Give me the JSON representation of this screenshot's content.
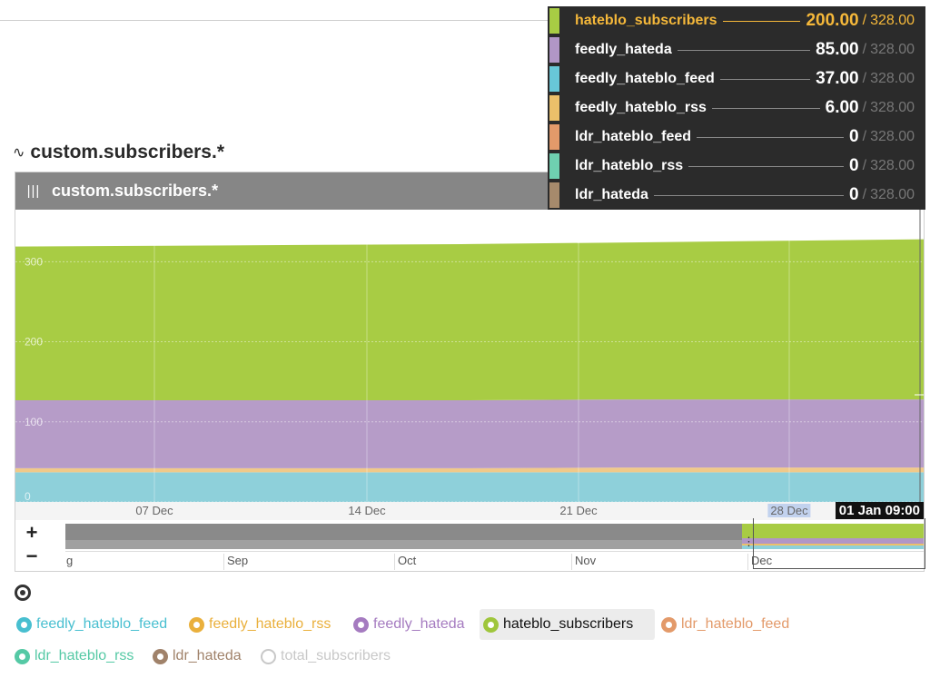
{
  "page": {
    "section_title": "custom.subscribers.*",
    "section_icon": "line-chart-icon"
  },
  "panel": {
    "title": "custom.subscribers.*",
    "menu_icon": "hamburger-icon"
  },
  "tooltip": {
    "total": "328.00",
    "rows": [
      {
        "name": "hateblo_subscribers",
        "value": "200.00",
        "color": "#a8cc44",
        "highlighted": true
      },
      {
        "name": "feedly_hateda",
        "value": "85.00",
        "color": "#b196c6"
      },
      {
        "name": "feedly_hateblo_feed",
        "value": "37.00",
        "color": "#68c7d8"
      },
      {
        "name": "feedly_hateblo_rss",
        "value": "6.00",
        "color": "#ecc06a"
      },
      {
        "name": "ldr_hateblo_feed",
        "value": "0",
        "color": "#e39a6a"
      },
      {
        "name": "ldr_hateblo_rss",
        "value": "0",
        "color": "#6fd0b0"
      },
      {
        "name": "ldr_hateda",
        "value": "0",
        "color": "#a68a6c"
      }
    ]
  },
  "chart_data": {
    "type": "area",
    "stacked": true,
    "x_ticks": [
      "07 Dec",
      "14 Dec",
      "21 Dec",
      "28 Dec"
    ],
    "selected_tick": "28 Dec",
    "cursor_time": "01 Jan 09:00",
    "y_ticks": [
      "0",
      "100",
      "200",
      "300"
    ],
    "ylim": [
      0,
      365
    ],
    "series": [
      {
        "name": "feedly_hateblo_feed",
        "color": "#8ed0da",
        "values": [
          37,
          37,
          37,
          37,
          37,
          37,
          37
        ]
      },
      {
        "name": "feedly_hateblo_rss",
        "color": "#f0c98a",
        "values": [
          5,
          5,
          5,
          5,
          6,
          6,
          6
        ]
      },
      {
        "name": "feedly_hateda",
        "color": "#b69cc8",
        "values": [
          85,
          85,
          85,
          85,
          85,
          85,
          85
        ]
      },
      {
        "name": "hateblo_subscribers",
        "color": "#a8cc44",
        "values": [
          192,
          193,
          194,
          195,
          196,
          198,
          200
        ]
      }
    ],
    "grid": true
  },
  "navigator": {
    "labels": [
      "g",
      "Sep",
      "Oct",
      "Nov",
      "Dec"
    ],
    "zoom_in": "+",
    "zoom_out": "−",
    "handle": "⋮"
  },
  "legend": {
    "toggle_icon": "visibility-toggle-icon",
    "items": [
      {
        "label": "feedly_hateblo_feed",
        "color": "#48bfd0"
      },
      {
        "label": "feedly_hateblo_rss",
        "color": "#eab03c"
      },
      {
        "label": "feedly_hateda",
        "color": "#a57bc0"
      },
      {
        "label": "hateblo_subscribers",
        "color": "#9fc63c",
        "active": true
      },
      {
        "label": "ldr_hateblo_feed",
        "color": "#e39a6a"
      },
      {
        "label": "ldr_hateblo_rss",
        "color": "#55c9a5"
      },
      {
        "label": "ldr_hateda",
        "color": "#a0826a"
      },
      {
        "label": "total_subscribers",
        "color": "#c8c8c8",
        "hollow": true
      }
    ]
  }
}
